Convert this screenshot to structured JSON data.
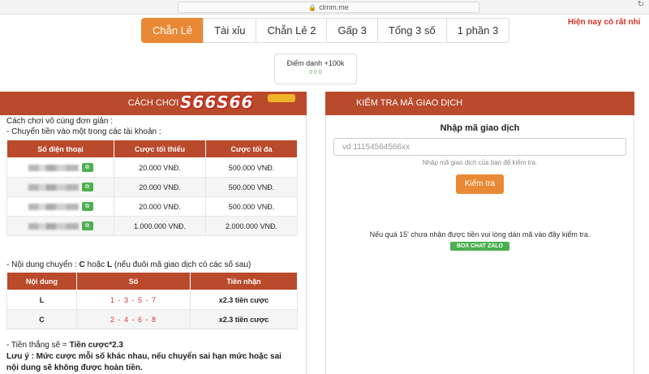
{
  "browser": {
    "url": "clmm.me"
  },
  "tabs": [
    {
      "label": "Chẵn Lẻ",
      "active": true
    },
    {
      "label": "Tài xỉu"
    },
    {
      "label": "Chẵn Lẻ 2"
    },
    {
      "label": "Gấp 3"
    },
    {
      "label": "Tổng 3 số"
    },
    {
      "label": "1 phần 3"
    }
  ],
  "marquee": "Hiện nay có rất nhi",
  "checkin": {
    "title": "Điểm danh +100k",
    "stats": "0 0 0"
  },
  "left": {
    "title": "CÁCH CHƠI",
    "logo": "S66S66",
    "intro1": "Cách chơi vô cùng đơn giản :",
    "intro2": "- Chuyển tiền vào một trong các tài khoản :",
    "accounts_headers": [
      "Số điện thoại",
      "Cược tối thiểu",
      "Cược tối đa"
    ],
    "accounts": [
      {
        "min": "20.000 VNĐ.",
        "max": "500.000 VNĐ."
      },
      {
        "min": "20.000 VNĐ.",
        "max": "500.000 VNĐ."
      },
      {
        "min": "20.000 VNĐ.",
        "max": "500.000 VNĐ."
      },
      {
        "min": "1.000.000 VNĐ.",
        "max": "2.000.000 VNĐ."
      }
    ],
    "content_note_prefix": "- Nội dung chuyển : ",
    "content_note_c": "C",
    "content_note_mid": " hoặc ",
    "content_note_l": "L",
    "content_note_suffix": " (nếu đuôi mã giao dịch có các số sau)",
    "rules_headers": [
      "Nội dung",
      "Số",
      "Tiền nhận"
    ],
    "rules": [
      {
        "content": "L",
        "numbers": "1 - 3 - 5 - 7",
        "payout": "x2.3 tiền cược"
      },
      {
        "content": "C",
        "numbers": "2 - 4 - 6 - 8",
        "payout": "x2.3 tiền cược"
      }
    ],
    "win_prefix": "- Tiền thắng sẽ = ",
    "win_formula": "Tiền cược*2.3",
    "warning_line1": "Lưu ý : Mức cược mỗi số khác nhau, nếu chuyển sai hạn mức hoặc sai",
    "warning_line2": "nội dung sẽ không được hoàn tiền."
  },
  "right": {
    "title": "KIỂM TRA MÃ GIAO DỊCH",
    "input_label": "Nhập mã giao dịch",
    "input_placeholder": "vd 11154564566xx",
    "hint": "Nhập mã giao dịch của bạn để kiểm tra.",
    "button": "Kiểm tra",
    "note": "Nếu quá 15' chưa nhận được tiền vui lòng dán mã vào đây kiểm tra.",
    "zalo": "BOX CHAT ZALO"
  }
}
